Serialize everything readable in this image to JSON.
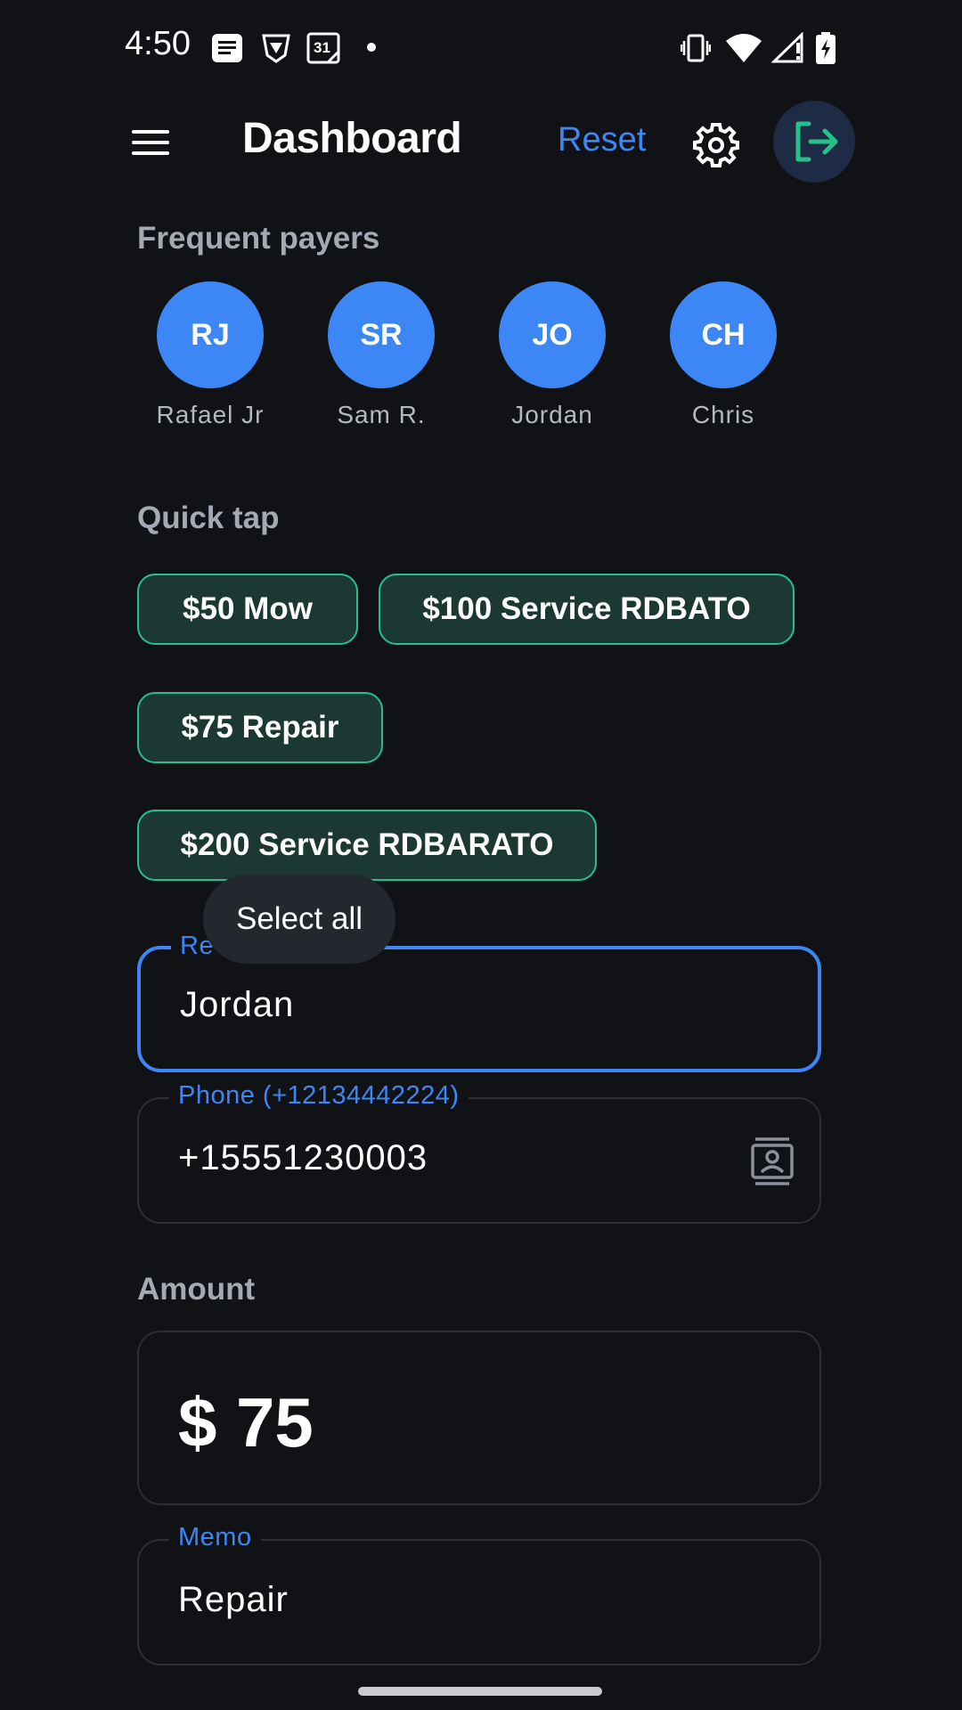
{
  "status_bar": {
    "time": "4:50",
    "left_icons": [
      "message-icon",
      "vpn-shield-icon",
      "calendar-icon"
    ],
    "calendar_day": "31",
    "right_icons": [
      "vibrate-icon",
      "wifi-icon",
      "signal-icon",
      "battery-charging-icon"
    ]
  },
  "app_bar": {
    "title": "Dashboard",
    "reset_label": "Reset",
    "icons": [
      "menu-icon",
      "settings-icon",
      "logout-icon"
    ]
  },
  "frequent_payers": {
    "label": "Frequent payers",
    "items": [
      {
        "initials": "RJ",
        "name": "Rafael Jr"
      },
      {
        "initials": "SR",
        "name": "Sam R."
      },
      {
        "initials": "JO",
        "name": "Jordan"
      },
      {
        "initials": "CH",
        "name": "Chris"
      }
    ]
  },
  "quick_tap": {
    "label": "Quick tap",
    "chips": [
      "$50 Mow",
      "$100 Service RDBATO",
      "$75 Repair",
      "$200 Service RDBARATO"
    ]
  },
  "tooltip": {
    "text": "Select all"
  },
  "form": {
    "recipient": {
      "label_visible": "Re",
      "value": "Jordan"
    },
    "phone": {
      "label": "Phone (+12134442224)",
      "value": "+15551230003"
    },
    "amount": {
      "label": "Amount",
      "value": "$ 75"
    },
    "memo": {
      "label": "Memo",
      "value": "Repair"
    }
  },
  "colors": {
    "background": "#101216",
    "accent_blue": "#3d86f5",
    "chip_border": "#28c08a",
    "chip_fill": "#1b3832"
  }
}
